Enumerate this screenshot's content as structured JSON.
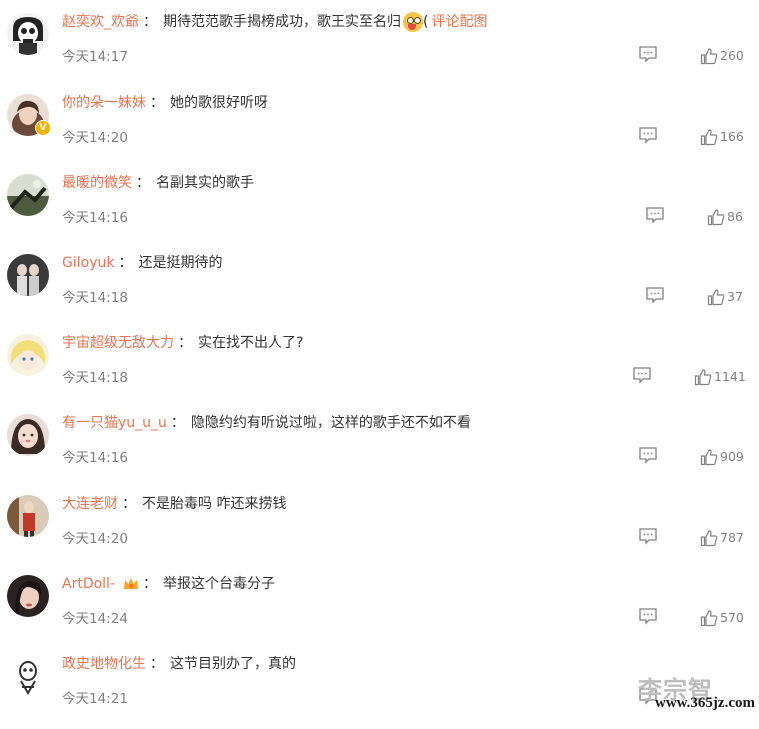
{
  "comments": [
    {
      "user": "赵奕欢_欢爺",
      "text": "期待范范歌手揭榜成功，歌王实至名归",
      "extra_link": "评论配图",
      "time": "今天14:17",
      "likes": "260",
      "avatar": "skull-avatar"
    },
    {
      "user": "你的朵一妹妹",
      "text": "她的歌很好听呀",
      "time": "今天14:20",
      "likes": "166",
      "avatar": "girl-avatar",
      "verified_badge": "V"
    },
    {
      "user": "最暖的微笑",
      "text": "名副其实的歌手",
      "time": "今天14:16",
      "likes": "86",
      "avatar": "landscape-avatar"
    },
    {
      "user": "Giloyuk",
      "text": "还是挺期待的",
      "time": "今天14:18",
      "likes": "37",
      "avatar": "couple-avatar"
    },
    {
      "user": "宇宙超级无敌大力",
      "text": "实在找不出人了?",
      "time": "今天14:18",
      "likes": "1141",
      "avatar": "anime-avatar"
    },
    {
      "user": "有一只猫yu_u_u",
      "text": "隐隐约约有听说过啦，这样的歌手还不如不看",
      "time": "今天14:16",
      "likes": "909",
      "avatar": "face-avatar"
    },
    {
      "user": "大连老财",
      "text": "不是胎毒吗 咋还来捞钱",
      "time": "今天14:20",
      "likes": "787",
      "avatar": "standing-avatar"
    },
    {
      "user": "ArtDoll-",
      "text": "举报这个台毒分子",
      "time": "今天14:24",
      "likes": "570",
      "avatar": "portrait-avatar",
      "member_icon": "crown-icon"
    },
    {
      "user": "政史地物化生",
      "text": "这节目别办了，真的",
      "time": "今天14:21",
      "likes": "",
      "avatar": "mask-avatar"
    }
  ],
  "colors": {
    "username": "#eb7350",
    "text": "#333333",
    "meta": "#808080"
  },
  "watermark": {
    "text": "李宗智",
    "url": "www.365jz.com"
  }
}
